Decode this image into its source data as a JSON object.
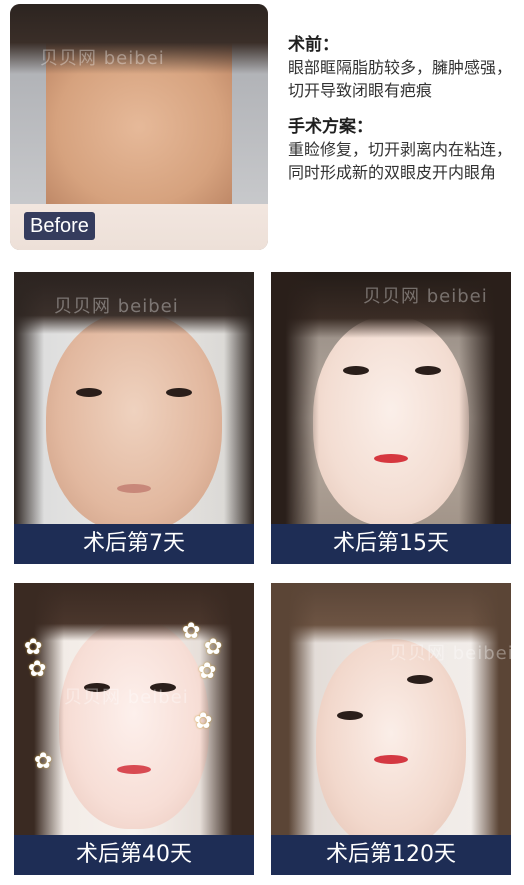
{
  "before": {
    "badge": "Before"
  },
  "info": {
    "section1": {
      "heading": "术前：",
      "body": "眼部眶隔脂肪较多，臃肿感强，切开导致闭眼有疤痕"
    },
    "section2": {
      "heading": "手术方案：",
      "body": "重睑修复，切开剥离内在粘连，同时形成新的双眼皮开内眼角"
    }
  },
  "results": [
    {
      "caption": "术后第7天"
    },
    {
      "caption": "术后第15天"
    },
    {
      "caption": "术后第40天"
    },
    {
      "caption": "术后第120天"
    }
  ],
  "watermark": {
    "text": "贝贝网 beibei"
  },
  "colors": {
    "caption_bg": "#1e2d55",
    "badge_bg": "#141e46",
    "heading_text": "#1f1f1f",
    "body_text": "#333333"
  }
}
